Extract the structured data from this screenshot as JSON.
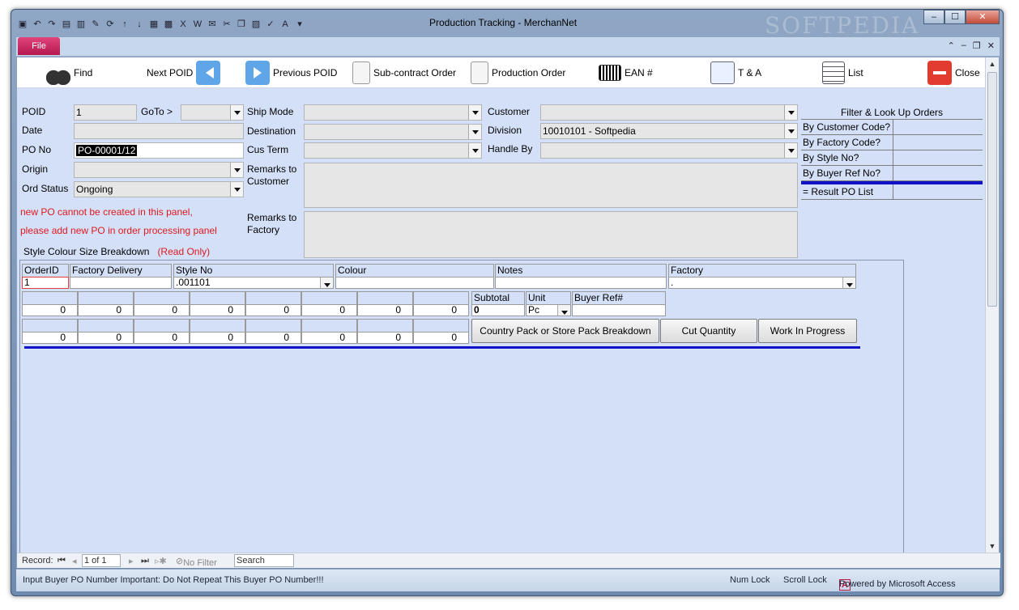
{
  "window": {
    "title": "Production Tracking  -  MerchanNet",
    "watermark": "SOFTPEDIA"
  },
  "ribbon": {
    "file_tab": "File"
  },
  "toolbar": {
    "find": "Find",
    "next_poid": "Next POID",
    "previous_poid": "Previous POID",
    "subcontract": "Sub-contract Order",
    "production_order": "Production Order",
    "ean": "EAN #",
    "ta": "T & A",
    "list": "List",
    "close": "Close"
  },
  "form": {
    "poid": {
      "label": "POID",
      "value": "1"
    },
    "goto": {
      "label": "GoTo >",
      "value": ""
    },
    "date": {
      "label": "Date",
      "value": ""
    },
    "po_no": {
      "label": "PO No",
      "value": "PO-00001/12"
    },
    "origin": {
      "label": "Origin",
      "value": ""
    },
    "ord_status": {
      "label": "Ord Status",
      "value": "Ongoing"
    },
    "ship_mode": {
      "label": "Ship Mode",
      "value": ""
    },
    "destination": {
      "label": "Destination",
      "value": ""
    },
    "cus_term": {
      "label": "Cus Term",
      "value": ""
    },
    "remarks_customer": {
      "label_1": "Remarks to",
      "label_2": "Customer",
      "value": ""
    },
    "remarks_factory": {
      "label_1": "Remarks to",
      "label_2": "Factory",
      "value": ""
    },
    "customer": {
      "label": "Customer",
      "value": ""
    },
    "division": {
      "label": "Division",
      "value": "10010101 - Softpedia"
    },
    "handle_by": {
      "label": "Handle By",
      "value": ""
    },
    "warning_1": "new PO cannot be created in this panel,",
    "warning_2": "please add new PO in order processing panel",
    "breakdown_label": "Style Colour Size Breakdown",
    "read_only": "(Read Only)"
  },
  "filter": {
    "header": "Filter & Look Up Orders",
    "rows": [
      "By Customer Code?",
      "By Factory Code?",
      "By Style No?",
      "By Buyer Ref No?"
    ],
    "result": "= Result PO List"
  },
  "subform": {
    "headers": {
      "order_id": "OrderID",
      "factory_delivery": "Factory Delivery",
      "style_no": "Style No",
      "colour": "Colour",
      "notes": "Notes",
      "factory": "Factory"
    },
    "values": {
      "order_id": "1",
      "factory_delivery": "",
      "style_no": ".001101",
      "colour": "",
      "notes": "",
      "factory": "."
    },
    "row1_values": [
      "0",
      "0",
      "0",
      "0",
      "0",
      "0",
      "0",
      "0"
    ],
    "row2_values": [
      "0",
      "0",
      "0",
      "0",
      "0",
      "0",
      "0",
      "0"
    ],
    "subtotal": {
      "label": "Subtotal",
      "value": "0"
    },
    "unit": {
      "label": "Unit",
      "value": "Pc"
    },
    "buyer_ref": {
      "label": "Buyer Ref#",
      "value": ""
    },
    "buttons": {
      "country_pack": "Country Pack or Store Pack Breakdown",
      "cut_quantity": "Cut Quantity",
      "work_in_progress": "Work In Progress"
    }
  },
  "record_nav": {
    "label": "Record:",
    "current": "1 of 1",
    "no_filter": "No Filter",
    "search": "Search"
  },
  "statusbar": {
    "message": "Input Buyer PO Number  Important:  Do Not Repeat This Buyer PO Number!!!",
    "num_lock": "Num Lock",
    "scroll_lock": "Scroll Lock",
    "powered": "Powered by Microsoft Access"
  }
}
